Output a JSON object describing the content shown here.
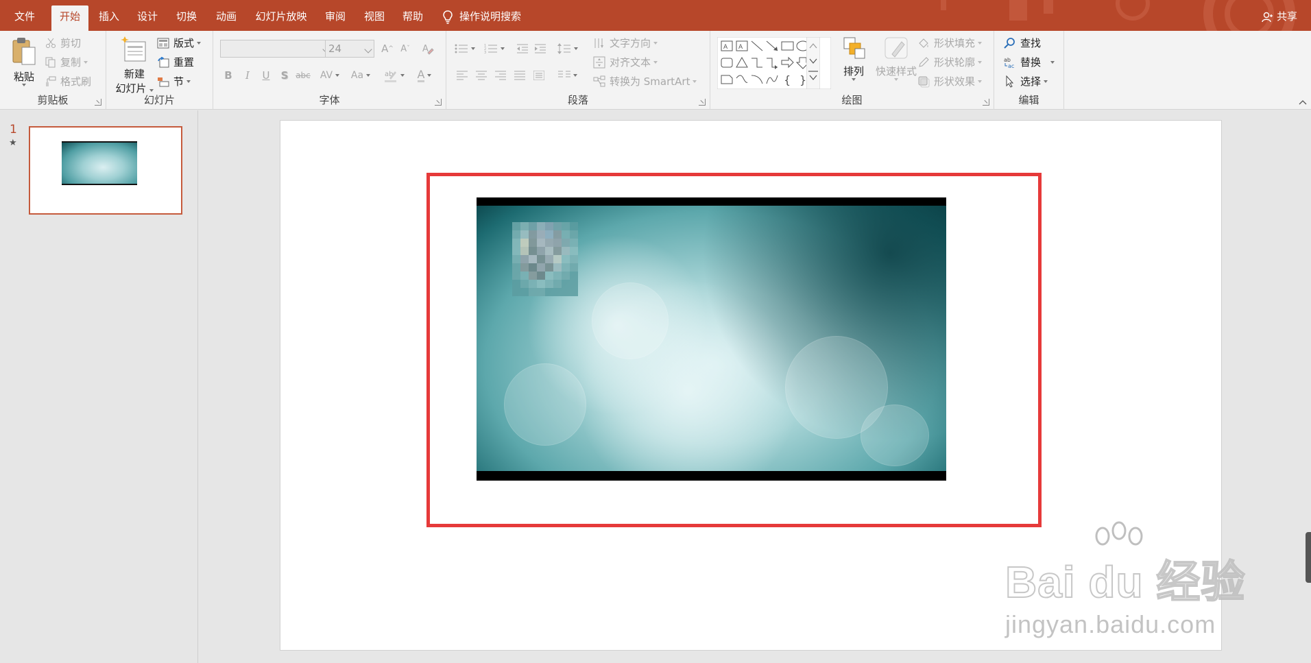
{
  "menu": {
    "tabs": [
      {
        "label": "文件",
        "active": false
      },
      {
        "label": "开始",
        "active": true
      },
      {
        "label": "插入",
        "active": false
      },
      {
        "label": "设计",
        "active": false
      },
      {
        "label": "切换",
        "active": false
      },
      {
        "label": "动画",
        "active": false
      },
      {
        "label": "幻灯片放映",
        "active": false
      },
      {
        "label": "审阅",
        "active": false
      },
      {
        "label": "视图",
        "active": false
      },
      {
        "label": "帮助",
        "active": false
      }
    ],
    "search_label": "操作说明搜索",
    "share_label": "共享"
  },
  "ribbon": {
    "clipboard": {
      "label": "剪贴板",
      "paste": "粘贴",
      "cut": "剪切",
      "copy": "复制",
      "format_painter": "格式刷"
    },
    "slides": {
      "label": "幻灯片",
      "new_slide_line1": "新建",
      "new_slide_line2": "幻灯片",
      "layout": "版式",
      "reset": "重置",
      "section": "节"
    },
    "font": {
      "label": "字体",
      "font_name": "",
      "font_size": "24",
      "grow": "A",
      "shrink": "A",
      "bold": "B",
      "italic": "I",
      "underline": "U",
      "shadow": "S",
      "strike": "abc",
      "spacing": "AV",
      "case": "Aa",
      "color": "A"
    },
    "paragraph": {
      "label": "段落",
      "text_direction": "文字方向",
      "align_text": "对齐文本",
      "smartart": "转换为 SmartArt"
    },
    "drawing": {
      "label": "绘图",
      "arrange": "排列",
      "quick_styles": "快速样式",
      "shape_fill": "形状填充",
      "shape_outline": "形状轮廓",
      "shape_effects": "形状效果"
    },
    "editing": {
      "label": "编辑",
      "find": "查找",
      "replace": "替换",
      "select": "选择"
    }
  },
  "thumbnails": {
    "slide_number": "1",
    "star": "★"
  },
  "watermark": {
    "main": "Bai du 经验",
    "sub": "jingyan.baidu.com"
  },
  "colors": {
    "accent": "#b7472a",
    "highlight_box": "#e63a3a"
  }
}
